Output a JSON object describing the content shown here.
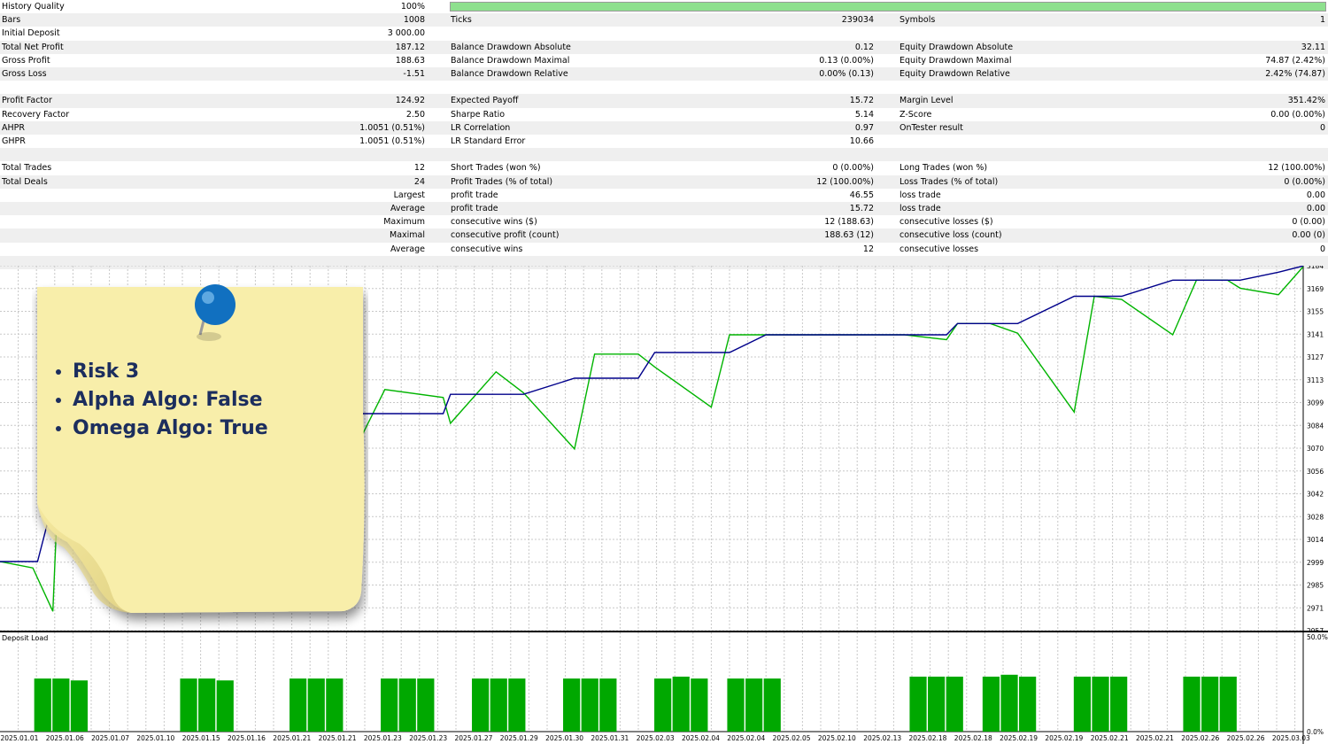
{
  "report": {
    "history_quality": {
      "label": "History Quality",
      "value": "100%",
      "fill_fraction": 1.0
    },
    "rows": [
      {
        "shaded": true,
        "cells": [
          "Bars",
          "1008",
          "Ticks",
          "239034",
          "Symbols",
          "1"
        ]
      },
      {
        "shaded": false,
        "cells": [
          "Initial Deposit",
          "3 000.00",
          "",
          "",
          "",
          ""
        ]
      },
      {
        "shaded": true,
        "cells": [
          "Total Net Profit",
          "187.12",
          "Balance Drawdown Absolute",
          "0.12",
          "Equity Drawdown Absolute",
          "32.11"
        ]
      },
      {
        "shaded": false,
        "cells": [
          "Gross Profit",
          "188.63",
          "Balance Drawdown Maximal",
          "0.13 (0.00%)",
          "Equity Drawdown Maximal",
          "74.87 (2.42%)"
        ]
      },
      {
        "shaded": true,
        "cells": [
          "Gross Loss",
          "-1.51",
          "Balance Drawdown Relative",
          "0.00% (0.13)",
          "Equity Drawdown Relative",
          "2.42% (74.87)"
        ]
      },
      {
        "shaded": false,
        "cells": [
          "",
          "",
          "",
          "",
          "",
          ""
        ]
      },
      {
        "shaded": true,
        "cells": [
          "Profit Factor",
          "124.92",
          "Expected Payoff",
          "15.72",
          "Margin Level",
          "351.42%"
        ]
      },
      {
        "shaded": false,
        "cells": [
          "Recovery Factor",
          "2.50",
          "Sharpe Ratio",
          "5.14",
          "Z-Score",
          "0.00 (0.00%)"
        ]
      },
      {
        "shaded": true,
        "cells": [
          "AHPR",
          "1.0051 (0.51%)",
          "LR Correlation",
          "0.97",
          "OnTester result",
          "0"
        ]
      },
      {
        "shaded": false,
        "cells": [
          "GHPR",
          "1.0051 (0.51%)",
          "LR Standard Error",
          "10.66",
          "",
          ""
        ]
      },
      {
        "shaded": true,
        "cells": [
          "",
          "",
          "",
          "",
          "",
          ""
        ]
      },
      {
        "shaded": false,
        "cells": [
          "Total Trades",
          "12",
          "Short Trades (won %)",
          "0 (0.00%)",
          "Long Trades (won %)",
          "12 (100.00%)"
        ]
      },
      {
        "shaded": true,
        "cells": [
          "Total Deals",
          "24",
          "Profit Trades (% of total)",
          "12 (100.00%)",
          "Loss Trades (% of total)",
          "0 (0.00%)"
        ]
      },
      {
        "shaded": false,
        "cells": [
          "",
          "Largest",
          "profit trade",
          "46.55",
          "loss trade",
          "0.00"
        ]
      },
      {
        "shaded": true,
        "cells": [
          "",
          "Average",
          "profit trade",
          "15.72",
          "loss trade",
          "0.00"
        ]
      },
      {
        "shaded": false,
        "cells": [
          "",
          "Maximum",
          "consecutive wins ($)",
          "12 (188.63)",
          "consecutive losses ($)",
          "0 (0.00)"
        ]
      },
      {
        "shaded": true,
        "cells": [
          "",
          "Maximal",
          "consecutive profit (count)",
          "188.63 (12)",
          "consecutive loss (count)",
          "0.00 (0)"
        ]
      },
      {
        "shaded": false,
        "cells": [
          "",
          "Average",
          "consecutive wins",
          "12",
          "consecutive losses",
          "0"
        ]
      },
      {
        "shaded": true,
        "cells": [
          "",
          "",
          "",
          "",
          "",
          ""
        ]
      }
    ]
  },
  "note": {
    "items": [
      "Risk 3",
      "Alpha Algo: False",
      "Omega Algo: True"
    ],
    "paper_color": "#f8eeaa",
    "pin_color": "#1170c0"
  },
  "colors": {
    "balance": "#00008b",
    "equity": "#00b400",
    "deposit_load": "#00a800",
    "grid": "#c8c8c8"
  },
  "chart_data": [
    {
      "type": "line",
      "title": "",
      "ylim": [
        2957,
        3184
      ],
      "y_ticks": [
        "3184",
        "3169",
        "3155",
        "3141",
        "3127",
        "3113",
        "3099",
        "3084",
        "3070",
        "3056",
        "3042",
        "3028",
        "3014",
        "2999",
        "2985",
        "2971",
        "2957"
      ],
      "x_ticks": [
        "2025.01.01",
        "2025.01.06",
        "2025.01.07",
        "2025.01.10",
        "2025.01.15",
        "2025.01.16",
        "2025.01.21",
        "2025.01.21",
        "2025.01.23",
        "2025.01.23",
        "2025.01.27",
        "2025.01.29",
        "2025.01.30",
        "2025.01.31",
        "2025.02.03",
        "2025.02.04",
        "2025.02.04",
        "2025.02.05",
        "2025.02.10",
        "2025.02.13",
        "2025.02.18",
        "2025.02.18",
        "2025.02.19",
        "2025.02.19",
        "2025.02.21",
        "2025.02.21",
        "2025.02.26",
        "2025.02.26",
        "2025.03.03"
      ],
      "series": [
        {
          "key": "balance",
          "x": [
            0,
            2.06,
            3.2,
            4.67,
            5.67,
            8.34,
            9.34,
            10.36,
            10.6,
            12.5,
            13.6,
            14.6,
            17.1,
            19.7,
            21.1,
            24.3,
            24.7,
            27.2,
            28.7,
            31.5,
            32.6,
            35.0,
            35.9,
            39.0,
            40.0,
            42.0,
            43.1,
            45.2,
            48.9,
            49.6,
            51.9,
            52.5,
            54.3,
            55.8,
            58.9,
            60.0,
            61.5,
            64.3,
            65.6,
            67.3,
            68.0,
            70.1,
            71.5
          ],
          "y": [
            3000,
            3000,
            3050,
            3063,
            3077,
            3077,
            3078,
            3078,
            3078,
            3092,
            3092,
            3092,
            3092,
            3092,
            3092,
            3092,
            3104,
            3104,
            3104,
            3114,
            3114,
            3114,
            3130,
            3130,
            3130,
            3141,
            3141,
            3141,
            3141,
            3141,
            3141,
            3148,
            3148,
            3148,
            3165,
            3165,
            3165,
            3175,
            3175,
            3175,
            3175,
            3180,
            3184
          ]
        },
        {
          "key": "equity",
          "x": [
            0,
            1.8,
            2.9,
            3.2,
            4.67,
            5.67,
            8.34,
            9.34,
            10.36,
            10.6,
            12.5,
            13.6,
            14.6,
            17.1,
            19.7,
            21.1,
            24.3,
            24.7,
            27.2,
            28.7,
            31.5,
            32.6,
            35.0,
            35.9,
            39.0,
            40.0,
            42.0,
            43.1,
            45.2,
            48.9,
            49.6,
            51.9,
            52.5,
            54.3,
            55.8,
            58.9,
            60.0,
            61.5,
            64.3,
            65.6,
            67.3,
            68.0,
            70.1,
            71.5
          ],
          "y": [
            3000,
            2996,
            2969,
            3050,
            3063,
            3077,
            3077,
            3078,
            3078,
            3078,
            3066,
            3092,
            3092,
            3090,
            3075,
            3107,
            3102,
            3086,
            3118,
            3105,
            3070,
            3129,
            3129,
            3121,
            3096,
            3141,
            3141,
            3141,
            3141,
            3141,
            3141,
            3138,
            3148,
            3148,
            3142,
            3093,
            3165,
            3163,
            3141,
            3175,
            3175,
            3170,
            3166,
            3184
          ]
        }
      ]
    },
    {
      "type": "bar",
      "title": "Deposit Load",
      "ylim": [
        0,
        50
      ],
      "y_ticks": [
        "50.0%",
        "0.0%"
      ],
      "bars": [
        {
          "x": 1.9,
          "v": 28
        },
        {
          "x": 2.9,
          "v": 28
        },
        {
          "x": 3.9,
          "v": 27
        },
        {
          "x": 9.9,
          "v": 28
        },
        {
          "x": 10.9,
          "v": 28
        },
        {
          "x": 11.9,
          "v": 27
        },
        {
          "x": 15.9,
          "v": 28
        },
        {
          "x": 16.9,
          "v": 28
        },
        {
          "x": 17.9,
          "v": 28
        },
        {
          "x": 20.9,
          "v": 28
        },
        {
          "x": 21.9,
          "v": 28
        },
        {
          "x": 22.9,
          "v": 28
        },
        {
          "x": 25.9,
          "v": 28
        },
        {
          "x": 26.9,
          "v": 28
        },
        {
          "x": 27.9,
          "v": 28
        },
        {
          "x": 30.9,
          "v": 28
        },
        {
          "x": 31.9,
          "v": 28
        },
        {
          "x": 32.9,
          "v": 28
        },
        {
          "x": 35.9,
          "v": 28
        },
        {
          "x": 36.9,
          "v": 29
        },
        {
          "x": 37.9,
          "v": 28
        },
        {
          "x": 39.9,
          "v": 28
        },
        {
          "x": 40.9,
          "v": 28
        },
        {
          "x": 41.9,
          "v": 28
        },
        {
          "x": 49.9,
          "v": 29
        },
        {
          "x": 50.9,
          "v": 29
        },
        {
          "x": 51.9,
          "v": 29
        },
        {
          "x": 53.9,
          "v": 29
        },
        {
          "x": 54.9,
          "v": 30
        },
        {
          "x": 55.9,
          "v": 29
        },
        {
          "x": 58.9,
          "v": 29
        },
        {
          "x": 59.9,
          "v": 29
        },
        {
          "x": 60.9,
          "v": 29
        },
        {
          "x": 64.9,
          "v": 29
        },
        {
          "x": 65.9,
          "v": 29
        },
        {
          "x": 66.9,
          "v": 29
        }
      ]
    }
  ]
}
